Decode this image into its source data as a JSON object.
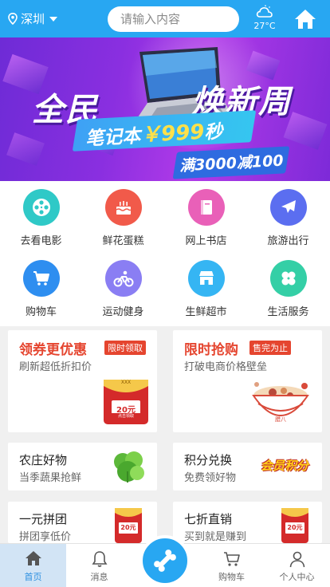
{
  "header": {
    "city": "深圳",
    "search_placeholder": "请输入内容",
    "temperature": "27°C",
    "location_icon": "location-pin-icon",
    "weather_icon": "cloud-icon",
    "home_icon": "home-icon"
  },
  "banner": {
    "title_left": "全民",
    "title_right": "焕新周",
    "subtitle_prefix": "笔记本",
    "subtitle_price": "￥999",
    "subtitle_suffix": "秒",
    "tag": "满3000减100",
    "slide_count": 5,
    "active_slide": 1
  },
  "grid": [
    {
      "label": "去看电影",
      "icon": "film-reel-icon",
      "color": "#2fc9c7"
    },
    {
      "label": "鲜花蛋糕",
      "icon": "cake-icon",
      "color": "#f15a4a"
    },
    {
      "label": "网上书店",
      "icon": "book-icon",
      "color": "#e960b8"
    },
    {
      "label": "旅游出行",
      "icon": "airplane-icon",
      "color": "#5b6ef0"
    },
    {
      "label": "购物车",
      "icon": "cart-icon",
      "color": "#2e8ef0"
    },
    {
      "label": "运动健身",
      "icon": "bicycle-icon",
      "color": "#8a7ef3"
    },
    {
      "label": "生鲜超市",
      "icon": "store-icon",
      "color": "#35b5f3"
    },
    {
      "label": "生活服务",
      "icon": "clover-icon",
      "color": "#34cfa6"
    }
  ],
  "promos": {
    "coupon": {
      "title": "领券更优惠",
      "badge": "限时领取",
      "sub": "刷新超低折扣价",
      "coupon_value": "20元",
      "coupon_note": "点击领取",
      "coupon_brand": "XXX"
    },
    "flash": {
      "title": "限时抢购",
      "badge": "售完为止",
      "sub": "打破电商价格壁垒",
      "bowl_text": "腊八"
    },
    "farm": {
      "title": "农庄好物",
      "sub": "当季蔬果抢鲜"
    },
    "points": {
      "title": "积分兑换",
      "sub": "免费领好物",
      "logo_text": "会员积分"
    },
    "group": {
      "title": "一元拼团",
      "sub": "拼团享低价",
      "coupon_value": "20元"
    },
    "discount": {
      "title": "七折直销",
      "sub": "买到就是赚到",
      "coupon_value": "20元"
    }
  },
  "nav": {
    "items": [
      {
        "label": "首页",
        "icon": "home-icon"
      },
      {
        "label": "消息",
        "icon": "bell-icon"
      },
      {
        "label": "购物车",
        "icon": "cart-icon"
      },
      {
        "label": "个人中心",
        "icon": "user-icon"
      }
    ],
    "center_icon": "bone-icon",
    "active": "首页"
  },
  "colors": {
    "primary": "#28a7f2",
    "accent_red": "#e5452f"
  }
}
